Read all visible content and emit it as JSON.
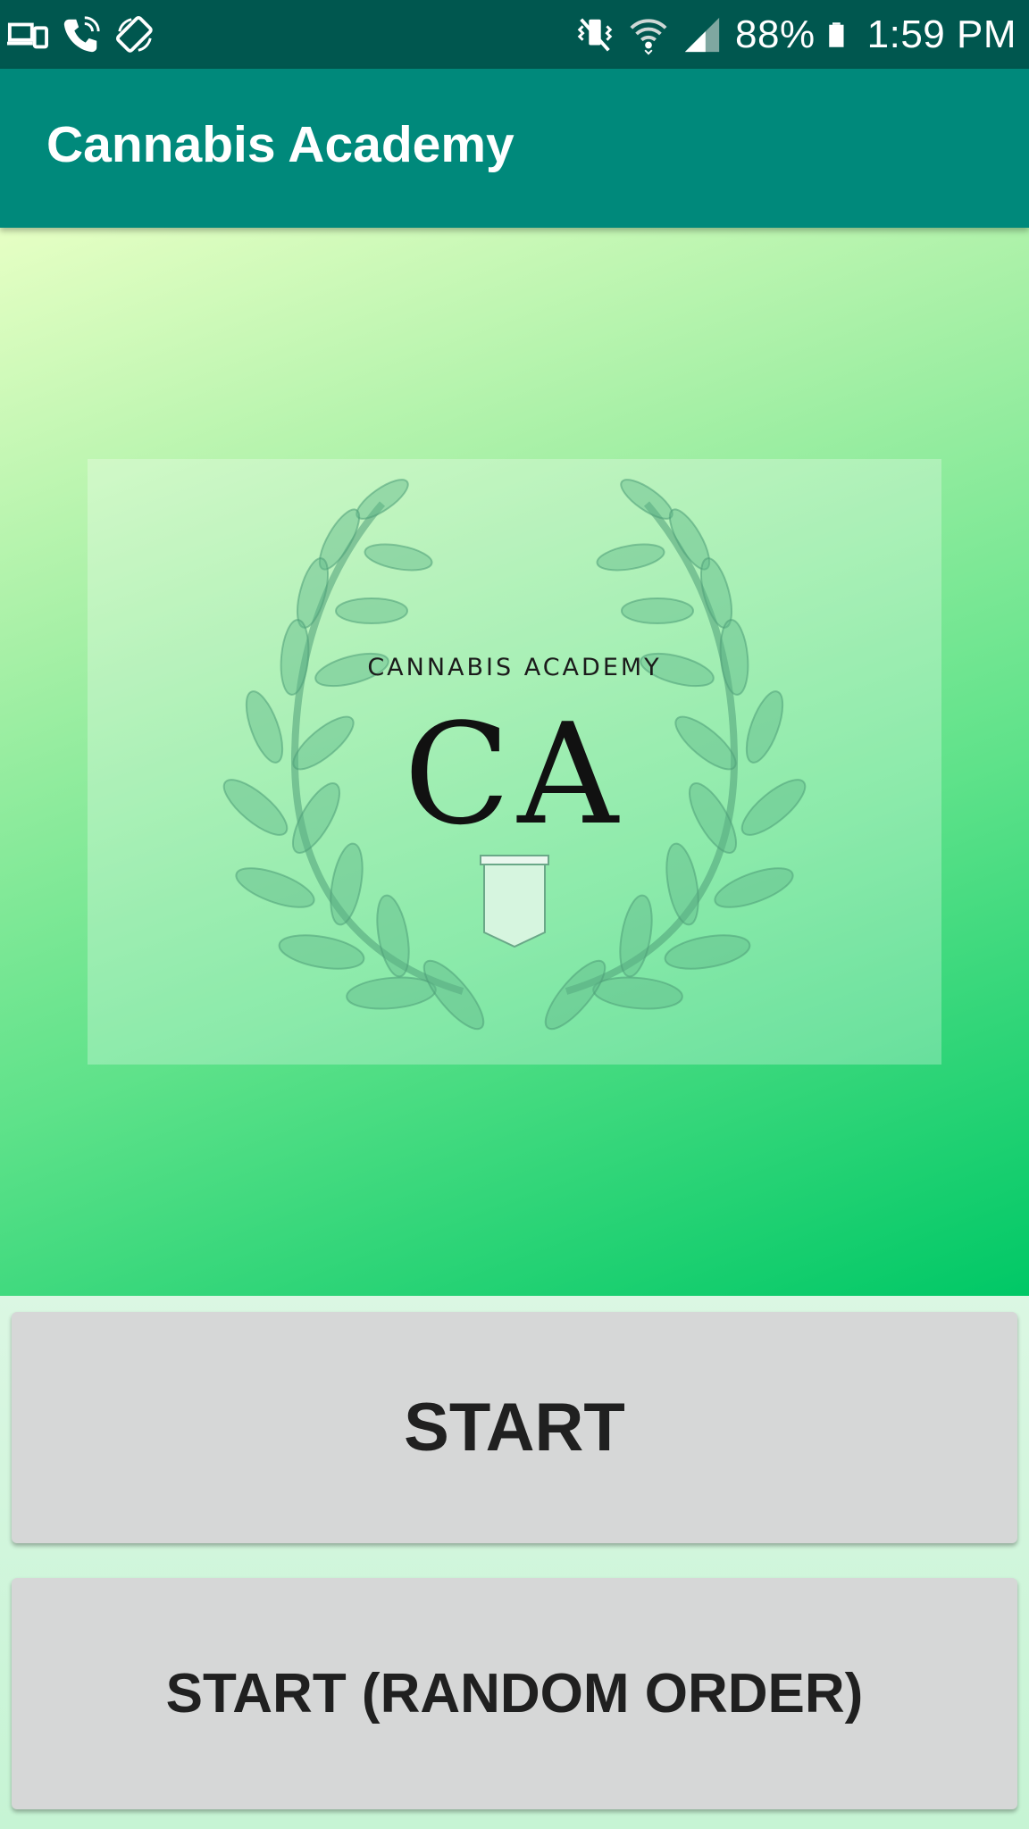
{
  "status_bar": {
    "left_icons": [
      "cast-devices-icon",
      "wifi-calling-icon",
      "auto-rotate-icon"
    ],
    "right_icons": [
      "vibrate-icon",
      "wifi-icon",
      "cell-signal-icon",
      "battery-icon"
    ],
    "battery": "88%",
    "battery_level": 0.88,
    "time": "1:59 PM"
  },
  "app_bar": {
    "title": "Cannabis Academy"
  },
  "logo": {
    "subtitle": "CANNABIS ACADEMY",
    "letters": "CA",
    "icon": "laurel-wreath-icon"
  },
  "buttons": {
    "start_label": "START",
    "random_label": "START (RANDOM ORDER)"
  },
  "colors": {
    "status_bar": "#00574f",
    "app_bar": "#00897b",
    "hero_top": "#e6ffc4",
    "hero_bottom": "#00c866",
    "button": "#d6d7d7"
  }
}
